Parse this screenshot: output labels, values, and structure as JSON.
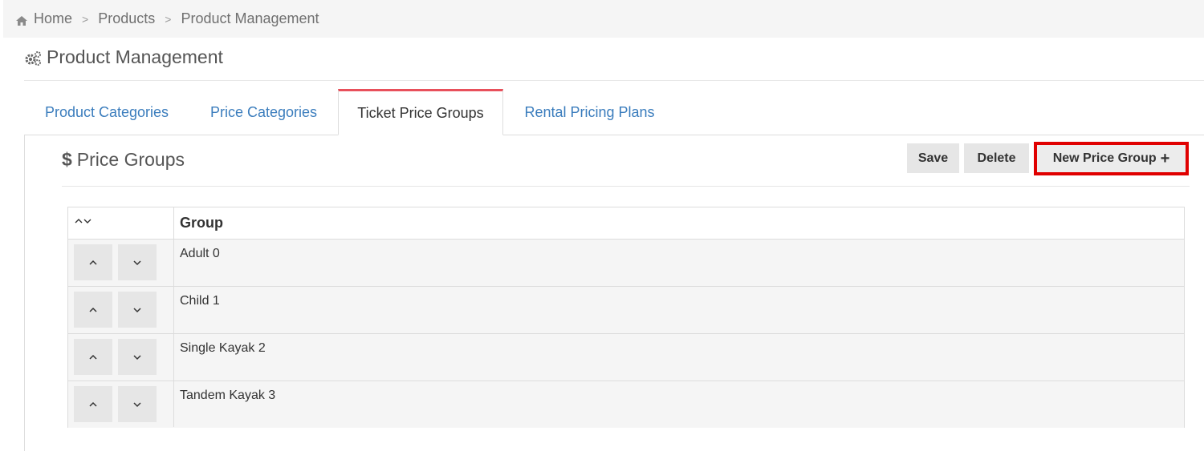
{
  "breadcrumb": {
    "home": "Home",
    "products": "Products",
    "current": "Product Management",
    "separator": ">"
  },
  "page": {
    "title": "Product Management"
  },
  "tabs": [
    {
      "label": "Product Categories",
      "active": false
    },
    {
      "label": "Price Categories",
      "active": false
    },
    {
      "label": "Ticket Price Groups",
      "active": true
    },
    {
      "label": "Rental Pricing Plans",
      "active": false
    }
  ],
  "section": {
    "icon": "$",
    "title": "Price Groups"
  },
  "toolbar": {
    "save_label": "Save",
    "delete_label": "Delete",
    "new_label": "New Price Group",
    "new_icon": "+"
  },
  "grid": {
    "sort_icon": "^v",
    "group_header": "Group",
    "up_glyph": "^",
    "down_glyph": "v",
    "rows": [
      {
        "label": "Adult 0"
      },
      {
        "label": "Child 1"
      },
      {
        "label": "Single Kayak 2"
      },
      {
        "label": "Tandem Kayak 3"
      }
    ]
  },
  "colors": {
    "accent_tab": "#e8505b",
    "highlight_border": "#e00000",
    "link": "#3b7dbd"
  }
}
